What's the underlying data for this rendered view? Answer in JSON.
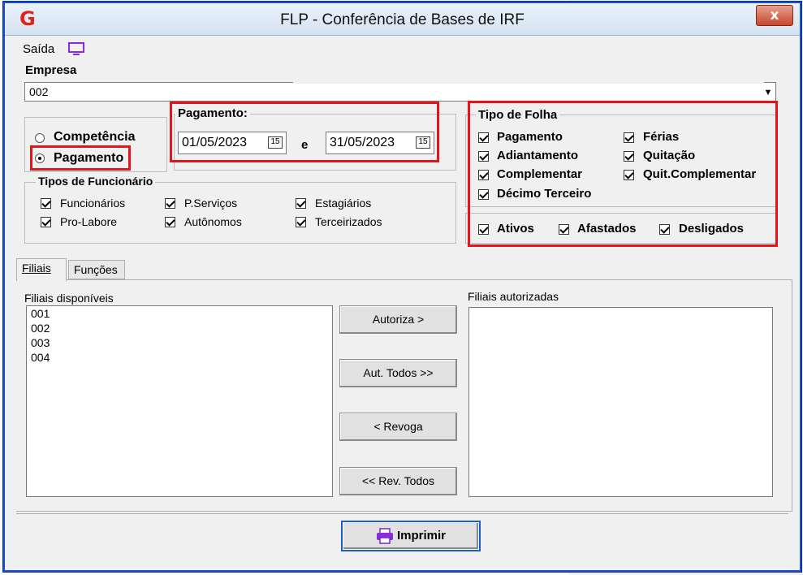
{
  "window": {
    "title": "FLP - Conferência de Bases de IRF",
    "close_label": "x",
    "logo_letter": "G"
  },
  "toolbar": {
    "saida_label": "Saída"
  },
  "empresa": {
    "label": "Empresa",
    "value": "002"
  },
  "periodo": {
    "competencia_label": "Competência",
    "pagamento_label": "Pagamento",
    "selected": "Pagamento"
  },
  "pagamento_group": {
    "title": "Pagamento:",
    "date_from": "01/05/2023",
    "connector": "e",
    "date_to": "31/05/2023",
    "calendar_label": "15"
  },
  "tipos_funcionario": {
    "title": "Tipos de Funcionário",
    "items": [
      {
        "label": "Funcionários",
        "checked": true
      },
      {
        "label": "Pro-Labore",
        "checked": true
      },
      {
        "label": "P.Serviços",
        "checked": true
      },
      {
        "label": "Autônomos",
        "checked": true
      },
      {
        "label": "Estagiários",
        "checked": true
      },
      {
        "label": "Terceirizados",
        "checked": true
      }
    ]
  },
  "tipo_folha": {
    "title": "Tipo de Folha",
    "items": [
      {
        "label": "Pagamento",
        "checked": true
      },
      {
        "label": "Adiantamento",
        "checked": true
      },
      {
        "label": "Complementar",
        "checked": true
      },
      {
        "label": "Décimo Terceiro",
        "checked": true
      },
      {
        "label": "Férias",
        "checked": true
      },
      {
        "label": "Quitação",
        "checked": true
      },
      {
        "label": "Quit.Complementar",
        "checked": true
      }
    ],
    "status_items": [
      {
        "label": "Ativos",
        "checked": true
      },
      {
        "label": "Afastados",
        "checked": true
      },
      {
        "label": "Desligados",
        "checked": true
      }
    ]
  },
  "tabs": [
    {
      "label": "Filiais",
      "active": true
    },
    {
      "label": "Funções",
      "active": false
    }
  ],
  "filiais": {
    "disponiveis_label": "Filiais disponíveis",
    "disponiveis": [
      "001",
      "002",
      "003",
      "004"
    ],
    "autorizadas_label": "Filiais autorizadas",
    "autorizadas": []
  },
  "buttons": {
    "autoriza": "Autoriza >",
    "aut_todos": "Aut. Todos >>",
    "revoga": "< Revoga",
    "rev_todos": "<< Rev. Todos",
    "imprimir": "Imprimir"
  }
}
